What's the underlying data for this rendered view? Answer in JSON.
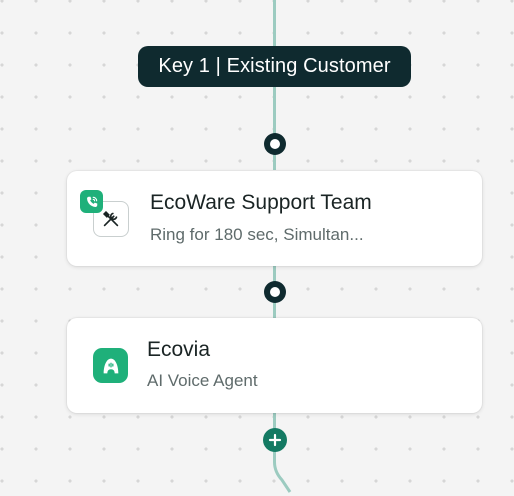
{
  "flow": {
    "key_label": "Key 1 | Existing Customer",
    "nodes": [
      {
        "title": "EcoWare Support Team",
        "subtitle": "Ring for 180 sec, Simultan...",
        "icon": "tools-icon",
        "badge_icon": "phone-call-icon"
      },
      {
        "title": "Ecovia",
        "subtitle": "AI Voice Agent",
        "icon": "ai-agent-icon"
      }
    ],
    "add_icon": "plus-icon"
  },
  "colors": {
    "background": "#f4f4f4",
    "connector": "#9ccbc0",
    "label_bg": "#0f2a2f",
    "accent_green": "#1fb07a",
    "add_button": "#147a63"
  }
}
